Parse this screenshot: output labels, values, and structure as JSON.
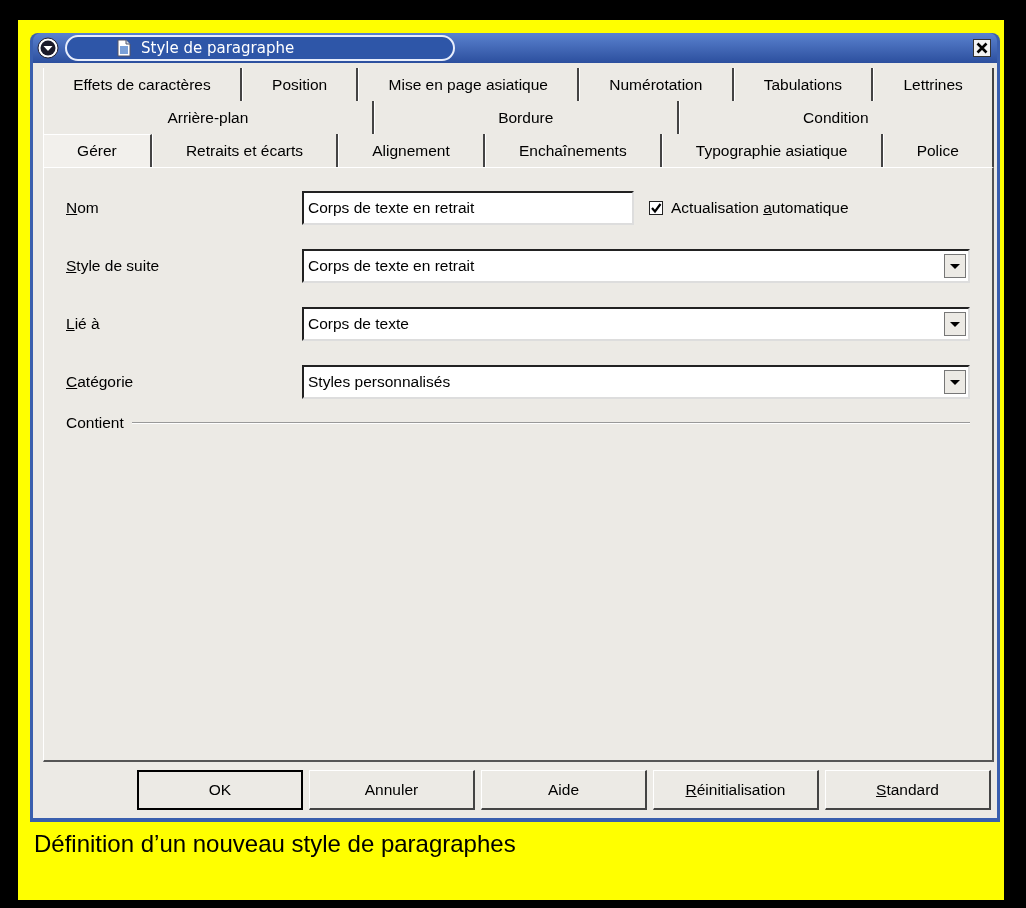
{
  "window": {
    "title": "Style de paragraphe"
  },
  "tab_rows": [
    [
      {
        "label": "Effets de caractères",
        "selected": false
      },
      {
        "label": "Position",
        "selected": false
      },
      {
        "label": "Mise en page asiatique",
        "selected": false
      },
      {
        "label": "Numérotation",
        "selected": false
      },
      {
        "label": "Tabulations",
        "selected": false
      },
      {
        "label": "Lettrines",
        "selected": false
      }
    ],
    [
      {
        "label": "Arrière-plan",
        "selected": false
      },
      {
        "label": "Bordure",
        "selected": false
      },
      {
        "label": "Condition",
        "selected": false
      }
    ],
    [
      {
        "label": "Gérer",
        "selected": true
      },
      {
        "label": "Retraits et écarts",
        "selected": false
      },
      {
        "label": "Alignement",
        "selected": false
      },
      {
        "label": "Enchaînements",
        "selected": false
      },
      {
        "label": "Typographie asiatique",
        "selected": false
      },
      {
        "label": "Police",
        "selected": false
      }
    ]
  ],
  "fields": [
    {
      "kind": "text",
      "label": {
        "key": "N",
        "after": "om"
      },
      "value": "Corps de texte en retrait",
      "checkbox": {
        "label": {
          "before": "Actualisation ",
          "key": "a",
          "after": "utomatique"
        },
        "checked": true
      }
    },
    {
      "kind": "dropdown",
      "label": {
        "key": "S",
        "after": "tyle de suite"
      },
      "value": "Corps de texte en retrait"
    },
    {
      "kind": "dropdown",
      "label": {
        "key": "L",
        "after": "ié à"
      },
      "value": "Corps de texte"
    },
    {
      "kind": "dropdown",
      "label": {
        "key": "C",
        "after": "atégorie"
      },
      "value": "Styles personnalisés"
    }
  ],
  "group": {
    "label": "Contient"
  },
  "buttons": [
    {
      "label": {
        "before": "OK"
      },
      "default": true
    },
    {
      "label": {
        "before": "Annuler"
      },
      "default": false
    },
    {
      "label": {
        "before": "Aide"
      },
      "default": false
    },
    {
      "label": {
        "key": "R",
        "after": "éinitialisation"
      },
      "default": false
    },
    {
      "label": {
        "key": "S",
        "after": "tandard"
      },
      "default": false
    }
  ],
  "caption": "Définition d’un nouveau style de paragraphes"
}
